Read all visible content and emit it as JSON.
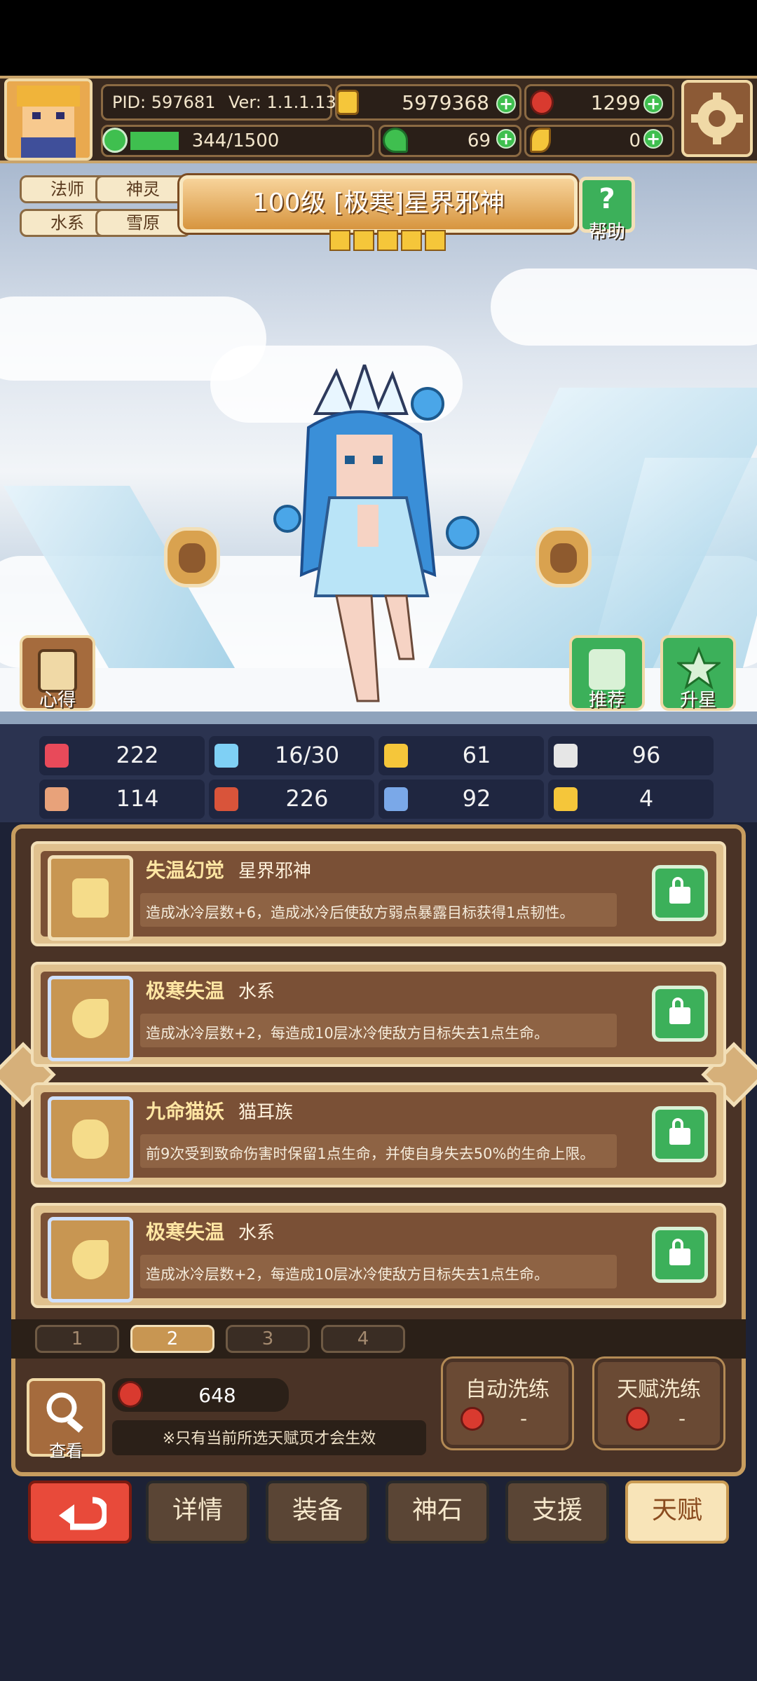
{
  "header": {
    "pid": "PID: 597681",
    "version": "Ver: 1.1.1.13",
    "gold": "5979368",
    "gems": "1299",
    "energy": "344/1500",
    "energy_fraction": 0.23,
    "clover": "69",
    "feather": "0"
  },
  "character": {
    "tags": [
      "法师",
      "神灵",
      "水系",
      "雪原"
    ],
    "title": "100级 [极寒]星界邪神",
    "stars": 5,
    "help_label": "帮助",
    "notes_label": "心得",
    "recommend_label": "推荐",
    "star_up_label": "升星"
  },
  "stats": [
    {
      "icon": "heart-icon",
      "value": "222"
    },
    {
      "icon": "water-drop-icon",
      "value": "16/30"
    },
    {
      "icon": "shield-icon",
      "value": "61"
    },
    {
      "icon": "wing-icon",
      "value": "96"
    },
    {
      "icon": "fist-icon",
      "value": "114"
    },
    {
      "icon": "book-icon",
      "value": "226"
    },
    {
      "icon": "boot-icon",
      "value": "92"
    },
    {
      "icon": "horseshoe-icon",
      "value": "4"
    }
  ],
  "talents": [
    {
      "name": "失温幻觉",
      "tag": "星界邪神",
      "desc": "造成冰冷层数+6，造成冰冷后使敌方弱点暴露目标获得1点韧性。",
      "icon": "star-icon"
    },
    {
      "name": "极寒失温",
      "tag": "水系",
      "desc": "造成冰冷层数+2，每造成10层冰冷使敌方目标失去1点生命。",
      "icon": "flame-icon"
    },
    {
      "name": "九命猫妖",
      "tag": "猫耳族",
      "desc": "前9次受到致命伤害时保留1点生命，并使自身失去50%的生命上限。",
      "icon": "cat-icon"
    },
    {
      "name": "极寒失温",
      "tag": "水系",
      "desc": "造成冰冷层数+2，每造成10层冰冷使敌方目标失去1点生命。",
      "icon": "flame-icon"
    }
  ],
  "pages": [
    "1",
    "2",
    "3",
    "4"
  ],
  "active_page": "2",
  "footer": {
    "view_label": "查看",
    "fruit_count": "648",
    "note": "※只有当前所选天赋页才会生效",
    "auto_wash": "自动洗练",
    "auto_wash_cost": "-",
    "talent_wash": "天赋洗练",
    "talent_wash_cost": "-"
  },
  "nav": [
    "详情",
    "装备",
    "神石",
    "支援",
    "天赋"
  ],
  "active_nav": "天赋"
}
